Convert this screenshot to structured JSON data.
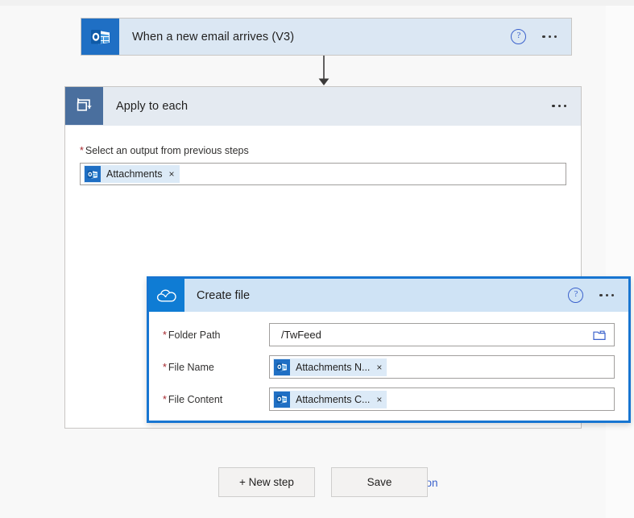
{
  "theme": {
    "page_bg": "#f8f8f8",
    "trigger_header_bg": "#dbe7f3",
    "loop_header_bg": "#e4eaf1",
    "createfile_header_bg": "#cfe3f5",
    "accent_blue": "#1775d1",
    "link_blue": "#3b62cc",
    "required_red": "#a4262c",
    "outlook_icon_bg": "#1f6fc4",
    "loop_icon_bg": "#4a6f9e",
    "onedrive_icon_bg": "#0f7cd4"
  },
  "trigger": {
    "title": "When a new email arrives (V3)",
    "icon": "outlook-icon",
    "help_glyph": "?",
    "menu_name": "more-commands"
  },
  "connector": {
    "icon": "arrow-down-icon"
  },
  "loop": {
    "title": "Apply to each",
    "icon": "loop-repeat-icon",
    "menu_name": "more-commands",
    "input": {
      "label": "Select an output from previous steps",
      "required_marker": "*",
      "token": {
        "text": "Attachments",
        "icon": "outlook-icon",
        "remove_glyph": "×"
      }
    }
  },
  "create_file": {
    "title": "Create file",
    "icon": "onedrive-cloud-icon",
    "help_glyph": "?",
    "menu_name": "more-commands",
    "fields": [
      {
        "label": "Folder Path",
        "required_marker": "*",
        "type": "text",
        "value": "/TwFeed",
        "trailing_icon": "folder-picker-icon"
      },
      {
        "label": "File Name",
        "required_marker": "*",
        "type": "token",
        "token_text": "Attachments N...",
        "token_icon": "outlook-icon",
        "remove_glyph": "×"
      },
      {
        "label": "File Content",
        "required_marker": "*",
        "type": "token",
        "token_text": "Attachments C...",
        "token_icon": "outlook-icon",
        "remove_glyph": "×"
      }
    ]
  },
  "add_action": {
    "label": "Add an action",
    "icon": "insert-action-icon"
  },
  "footer": {
    "new_step_label": "+ New step",
    "save_label": "Save"
  }
}
